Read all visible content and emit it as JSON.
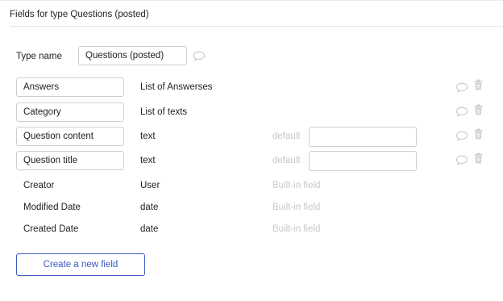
{
  "panel_title": "Fields for type Questions (posted)",
  "type_name": {
    "label": "Type name",
    "value": "Questions (posted)"
  },
  "custom_fields": [
    {
      "name": "Answers",
      "type": "List of Answerses",
      "has_default": false
    },
    {
      "name": "Category",
      "type": "List of texts",
      "has_default": false
    },
    {
      "name": "Question content",
      "type": "text",
      "has_default": true,
      "default_label": "default",
      "default_value": ""
    },
    {
      "name": "Question title",
      "type": "text",
      "has_default": true,
      "default_label": "default",
      "default_value": ""
    }
  ],
  "builtin_fields": [
    {
      "name": "Creator",
      "type": "User",
      "note": "Built-in field"
    },
    {
      "name": "Modified Date",
      "type": "date",
      "note": "Built-in field"
    },
    {
      "name": "Created Date",
      "type": "date",
      "note": "Built-in field"
    }
  ],
  "create_button_label": "Create a new field",
  "colors": {
    "accent": "#3d59c4",
    "muted_text": "#c8c8c8",
    "icon_gray": "#c9c9c9",
    "border": "#cfcfcf"
  },
  "icons": [
    "comment-icon",
    "trash-icon"
  ]
}
